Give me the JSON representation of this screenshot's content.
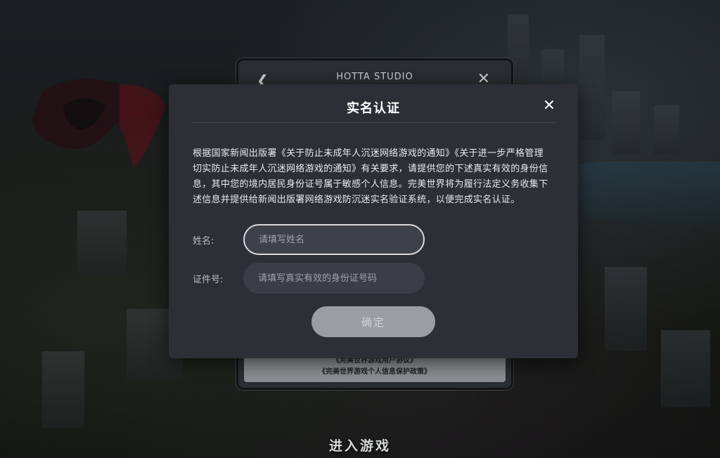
{
  "background": {
    "login_panel": {
      "logo_text": "HOTTA STUDIO",
      "back_icon": "chevron-left-icon",
      "close_icon": "close-icon",
      "agreement_line1": "《完美世界游戏用户协议》",
      "agreement_line2": "《完美世界游戏个人信息保护政策》"
    },
    "enter_game_label": "进入游戏"
  },
  "modal": {
    "title": "实名认证",
    "close_icon": "close-icon",
    "notice": "根据国家新闻出版署《关于防止未成年人沉迷网络游戏的通知》《关于进一步严格管理 切实防止未成年人沉迷网络游戏的通知》有关要求，请提供您的下述真实有效的身份信息，其中您的境内居民身份证号属于敏感个人信息。完美世界将为履行法定义务收集下述信息并提供给新闻出版署网络游戏防沉迷实名验证系统，以便完成实名认证。",
    "name_field": {
      "label": "姓名:",
      "placeholder": "请填写姓名",
      "value": ""
    },
    "id_field": {
      "label": "证件号:",
      "placeholder": "请填写真实有效的身份证号码",
      "value": ""
    },
    "confirm_label": "确定"
  },
  "colors": {
    "modal_bg": "#2c2f36",
    "input_bg": "#3a3e46",
    "confirm_bg_disabled": "#9a9da1",
    "text_primary": "#ffffff"
  }
}
